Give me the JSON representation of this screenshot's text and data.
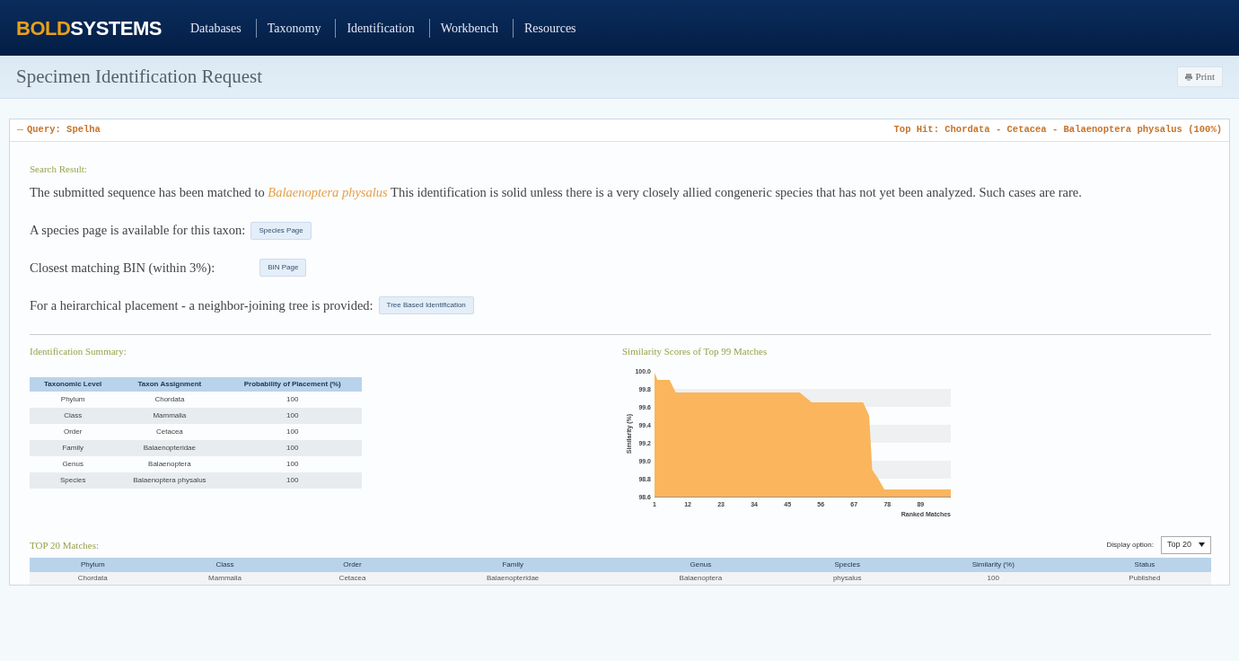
{
  "navbar": {
    "logo_bold": "BOLD",
    "logo_rest": "SYSTEMS",
    "menu": [
      "Databases",
      "Taxonomy",
      "Identification",
      "Workbench",
      "Resources"
    ]
  },
  "page_title": "Specimen Identification Request",
  "print_button": "Print",
  "query": {
    "label": "Query: Spelha",
    "expanded": true,
    "top_hit": "Top Hit: Chordata - Cetacea - Balaenoptera physalus (100%)"
  },
  "search_result": {
    "heading": "Search Result:",
    "sentence_before": "The submitted sequence has been matched to",
    "species_link": "Balaenoptera physalus",
    "sentence_after": "This identification is solid unless there is a very closely allied congeneric species that has not yet been analyzed. Such cases are rare.",
    "lines": [
      {
        "text": "A species page is available for this taxon:",
        "button": "Species Page"
      },
      {
        "text": "Closest matching BIN (within 3%):",
        "button": "BIN Page"
      },
      {
        "text": "For a heirarchical placement - a neighbor-joining tree is provided:",
        "button": "Tree Based Identification"
      }
    ]
  },
  "identification_summary": {
    "heading": "Identification Summary:",
    "columns": [
      "Taxonomic Level",
      "Taxon Assignment",
      "Probability of Placement (%)"
    ],
    "rows": [
      [
        "Phylum",
        "Chordata",
        "100"
      ],
      [
        "Class",
        "Mammalia",
        "100"
      ],
      [
        "Order",
        "Cetacea",
        "100"
      ],
      [
        "Family",
        "Balaenopteridae",
        "100"
      ],
      [
        "Genus",
        "Balaenoptera",
        "100"
      ],
      [
        "Species",
        "Balaenoptera physalus",
        "100"
      ]
    ]
  },
  "similarity": {
    "heading": "Similarity Scores of Top 99 Matches",
    "chart_data": {
      "type": "area",
      "xlabel": "Ranked Matches",
      "ylabel": "Similarity (%)",
      "x": [
        1,
        2,
        6,
        8,
        49,
        53,
        70,
        72,
        73,
        75,
        77,
        99
      ],
      "series": [
        {
          "color": "#fbb55c",
          "values": [
            99.98,
            99.9,
            99.9,
            99.76,
            99.76,
            99.65,
            99.65,
            99.5,
            98.9,
            98.8,
            98.68,
            98.68
          ]
        }
      ],
      "xlim": [
        1,
        99
      ],
      "ylim": [
        98.6,
        100.0
      ],
      "xticks": [
        1,
        12,
        23,
        34,
        45,
        56,
        67,
        78,
        89
      ],
      "yticks": [
        {
          "value": 98.6,
          "label": "98.6"
        },
        {
          "value": 98.8,
          "label": "98.8"
        },
        {
          "value": 99.0,
          "label": "99.0"
        },
        {
          "value": 99.2,
          "label": "99.2"
        },
        {
          "value": 99.4,
          "label": "99.4"
        },
        {
          "value": 99.6,
          "label": "99.6"
        },
        {
          "value": 99.8,
          "label": "99.8"
        },
        {
          "value": 100.0,
          "label": "100.0"
        }
      ]
    }
  },
  "matches": {
    "heading": "TOP 20 Matches:",
    "display_label": "Display option:",
    "display_value": "Top 20",
    "columns": [
      "Phylum",
      "Class",
      "Order",
      "Family",
      "Genus",
      "Species",
      "Similarity (%)",
      "Status"
    ],
    "rows": [
      [
        "Chordata",
        "Mammalia",
        "Cetacea",
        "Balaenopteridae",
        "Balaenoptera",
        "physalus",
        "100",
        "Published"
      ]
    ]
  }
}
